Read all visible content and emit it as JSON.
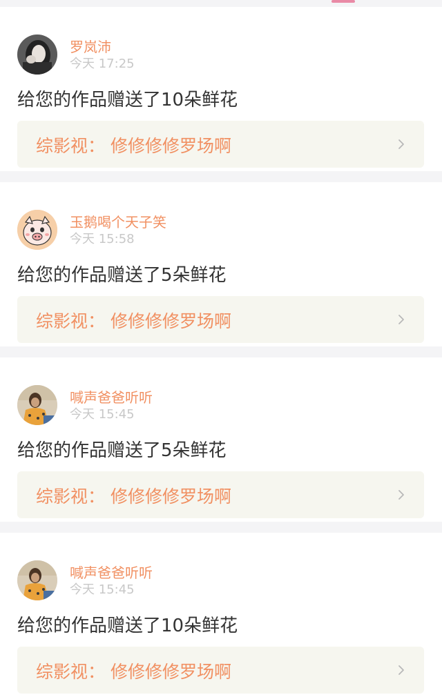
{
  "colors": {
    "accent": "#f19062",
    "indicator": "#e98aa6",
    "message": "#333333",
    "time": "#c8c8c8",
    "link_bg": "#f6f6ef",
    "divider": "#f4f4f6"
  },
  "feed": {
    "items": [
      {
        "avatar": "avatar-photo-girl",
        "username": "罗岚沛",
        "time": "今天 17:25",
        "message": "给您的作品赠送了10朵鲜花",
        "work_title": "综影视：  修修修修罗场啊"
      },
      {
        "avatar": "avatar-cartoon-pig",
        "username": "玉鹅喝个天子笑",
        "time": "今天 15:58",
        "message": "给您的作品赠送了5朵鲜花",
        "work_title": "综影视：  修修修修罗场啊"
      },
      {
        "avatar": "avatar-photo-person",
        "username": "喊声爸爸听听",
        "time": "今天 15:45",
        "message": "给您的作品赠送了5朵鲜花",
        "work_title": "综影视：  修修修修罗场啊"
      },
      {
        "avatar": "avatar-photo-person",
        "username": "喊声爸爸听听",
        "time": "今天 15:45",
        "message": "给您的作品赠送了10朵鲜花",
        "work_title": "综影视：  修修修修罗场啊"
      }
    ]
  }
}
